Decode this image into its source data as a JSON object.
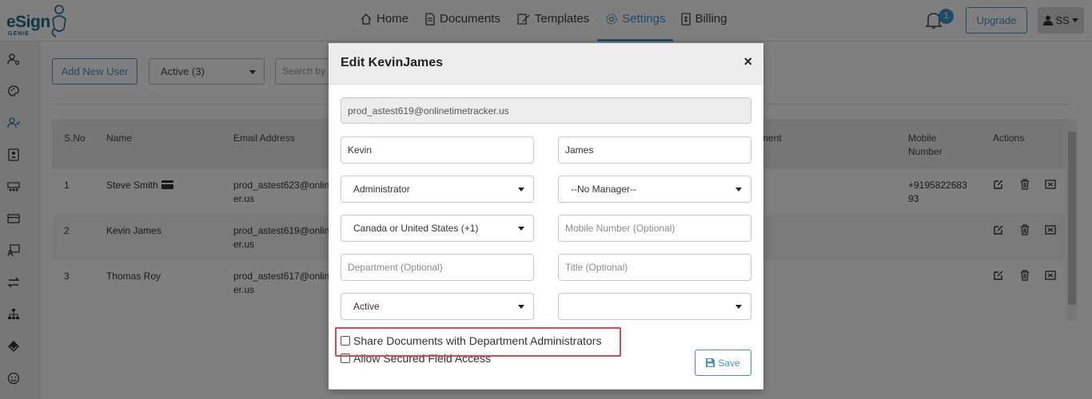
{
  "logo": {
    "brand": "eSign",
    "sub": "GENIE"
  },
  "nav": {
    "items": [
      {
        "label": "Home",
        "icon": "home-icon"
      },
      {
        "label": "Documents",
        "icon": "document-icon"
      },
      {
        "label": "Templates",
        "icon": "template-icon"
      },
      {
        "label": "Settings",
        "icon": "gear-icon",
        "active": true
      },
      {
        "label": "Billing",
        "icon": "billing-icon"
      }
    ],
    "notification_count": "1",
    "upgrade_label": "Upgrade",
    "user_initials": "SS"
  },
  "toolbar": {
    "add_user_label": "Add New User",
    "status_filter": "Active (3)",
    "search_placeholder": "Search by Name or Email"
  },
  "table": {
    "columns": {
      "sno": "S.No",
      "name": "Name",
      "email": "Email Address",
      "department": "Department",
      "mobile": "Mobile Number",
      "actions": "Actions"
    },
    "rows": [
      {
        "sno": "1",
        "name": "Steve Smith",
        "email_line1": "prod_astest623@onlin",
        "email_line2": "er.us",
        "mobile_line1": "+9195822683",
        "mobile_line2": "93"
      },
      {
        "sno": "2",
        "name": "Kevin James",
        "email_line1": "prod_astest619@onlin",
        "email_line2": "er.us",
        "mobile_line1": "",
        "mobile_line2": ""
      },
      {
        "sno": "3",
        "name": "Thomas Roy",
        "email_line1": "prod_astest617@onlin",
        "email_line2": "er.us",
        "mobile_line1": "",
        "mobile_line2": ""
      }
    ]
  },
  "modal": {
    "title": "Edit KevinJames",
    "close": "×",
    "email": "prod_astest619@onlinetimetracker.us",
    "first_name": "Kevin",
    "last_name": "James",
    "role": "Administrator",
    "manager": "--No Manager--",
    "country_code": "Canada or United States (+1)",
    "mobile_placeholder": "Mobile Number (Optional)",
    "department_placeholder": "Department (Optional)",
    "title_placeholder": "Title (Optional)",
    "status": "Active",
    "extra_select": "",
    "share_docs_label": "Share Documents with Department Administrators",
    "secured_field_label": "Allow Secured Field Access",
    "save_label": "Save"
  },
  "colors": {
    "accent": "#3c98c8",
    "highlight": "#e0464a"
  }
}
